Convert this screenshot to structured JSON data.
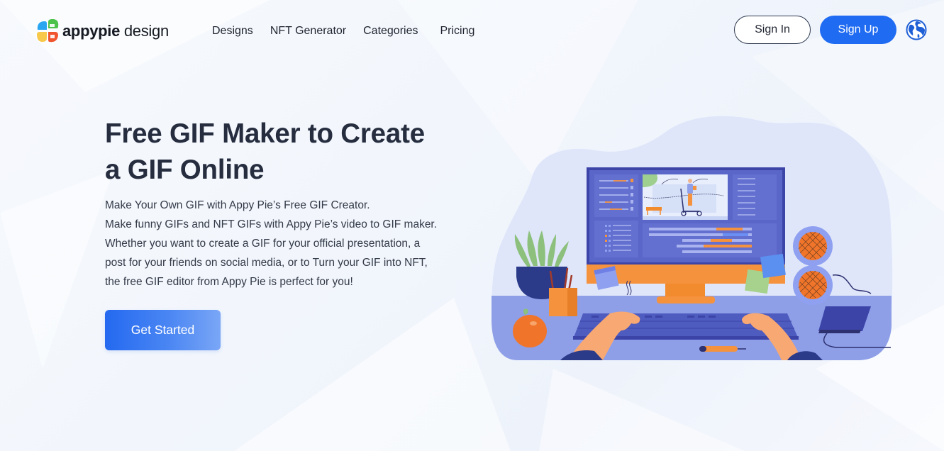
{
  "brand": {
    "name_bold": "appypie",
    "name_light": " design",
    "logo_colors": [
      "#2aa6f0",
      "#4cc24a",
      "#f7c84a",
      "#f0552e"
    ]
  },
  "nav": {
    "items": [
      {
        "label": "Designs"
      },
      {
        "label": "NFT Generator"
      },
      {
        "label": "Categories"
      },
      {
        "label": "Pricing"
      }
    ]
  },
  "header_actions": {
    "sign_in_label": "Sign In",
    "sign_up_label": "Sign Up",
    "language_icon": "globe-icon"
  },
  "hero": {
    "title_line1": "Free GIF Maker to Create",
    "title_line2": "a GIF Online",
    "description": [
      "Make Your Own GIF with Appy Pie’s Free GIF Creator.",
      "Make funny GIFs and NFT GIFs with Appy Pie’s video to GIF maker.",
      "Whether you want to create a GIF for your official presentation, a",
      "post for your friends on social media, or to Turn your GIF into NFT,",
      "the free GIF editor from Appy Pie is perfect for you!"
    ],
    "cta_label": "Get Started",
    "illustration": "video-editing-desk-illustration"
  },
  "colors": {
    "accent": "#1f6bf2",
    "heading": "#252d3f",
    "body_text": "#333a48",
    "illustration_blue": "#5a67c9",
    "illustration_orange": "#f5923e"
  }
}
